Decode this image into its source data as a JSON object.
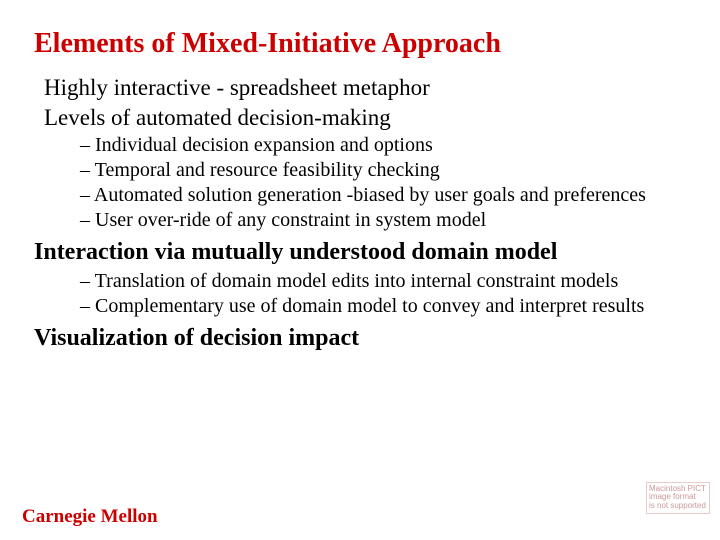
{
  "title": "Elements of Mixed-Initiative Approach",
  "points": {
    "p1": "Highly interactive - spreadsheet metaphor",
    "p2": "Levels of automated decision-making",
    "p2_items": {
      "a": "Individual decision expansion and options",
      "b": "Temporal and resource feasibility checking",
      "c": "Automated solution generation -biased by user goals and preferences",
      "d": "User over-ride of any constraint in system model"
    },
    "p3": "Interaction via mutually understood domain model",
    "p3_items": {
      "a": "Translation of domain model edits into internal constraint models",
      "b": "Complementary use of domain model to convey and interpret results"
    },
    "p4": "Visualization of decision impact"
  },
  "footer": "Carnegie Mellon",
  "stamp": {
    "l1": "Macintosh PICT",
    "l2": "image format",
    "l3": "is not supported"
  }
}
